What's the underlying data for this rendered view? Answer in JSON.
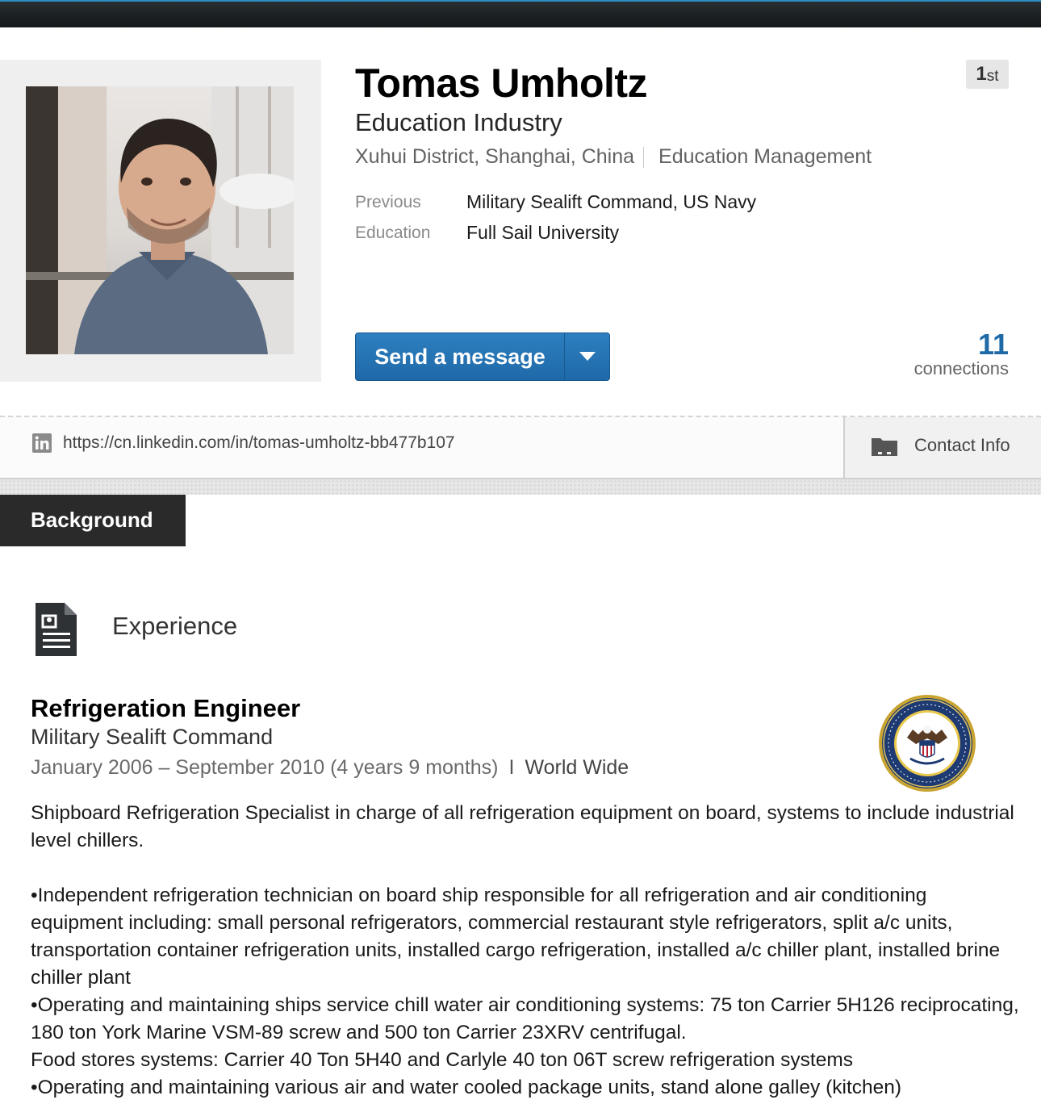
{
  "profile": {
    "name": "Tomas Umholtz",
    "headline": "Education Industry",
    "location": "Xuhui District, Shanghai, China",
    "industry": "Education Management",
    "degree_number": "1",
    "degree_suffix": "st",
    "previous_label": "Previous",
    "previous_value": "Military Sealift Command, US Navy",
    "education_label": "Education",
    "education_value": "Full Sail University",
    "send_message_label": "Send a message",
    "connections_count": "11",
    "connections_label": "connections"
  },
  "url_bar": {
    "url": "https://cn.linkedin.com/in/tomas-umholtz-bb477b107",
    "contact_info_label": "Contact Info"
  },
  "section_tab": {
    "label": "Background"
  },
  "experience": {
    "section_title": "Experience",
    "job_title": "Refrigeration Engineer",
    "company": "Military Sealift Command",
    "dates": "January 2006 – September 2010 (4 years 9 months)",
    "separator": "I",
    "location": "World Wide",
    "description": [
      "Shipboard Refrigeration Specialist in charge of all refrigeration equipment on board, systems to include industrial level chillers.",
      "•Independent refrigeration technician on board ship responsible for all refrigeration and air conditioning equipment including: small personal refrigerators, commercial restaurant style refrigerators, split a/c units, transportation container refrigeration units, installed cargo refrigeration, installed a/c chiller plant, installed brine chiller plant",
      "•Operating and maintaining ships service chill water air conditioning systems: 75 ton Carrier 5H126 reciprocating, 180 ton York Marine VSM-89 screw and 500 ton Carrier 23XRV centrifugal.",
      "Food stores systems: Carrier 40 Ton 5H40 and Carlyle 40 ton 06T screw refrigeration systems",
      "•Operating and maintaining various air and water cooled package units, stand alone galley (kitchen)"
    ]
  },
  "icons": {
    "caret": "chevron-down-icon",
    "linkedin": "linkedin-icon",
    "contact": "folder-card-icon",
    "experience": "resume-document-icon",
    "company_logo": "military-sealift-command-seal"
  },
  "colors": {
    "primary_button": "#2677b8",
    "connections": "#1f6aa6",
    "tab_background": "#2a2a2a",
    "top_band": "#1b2023"
  }
}
